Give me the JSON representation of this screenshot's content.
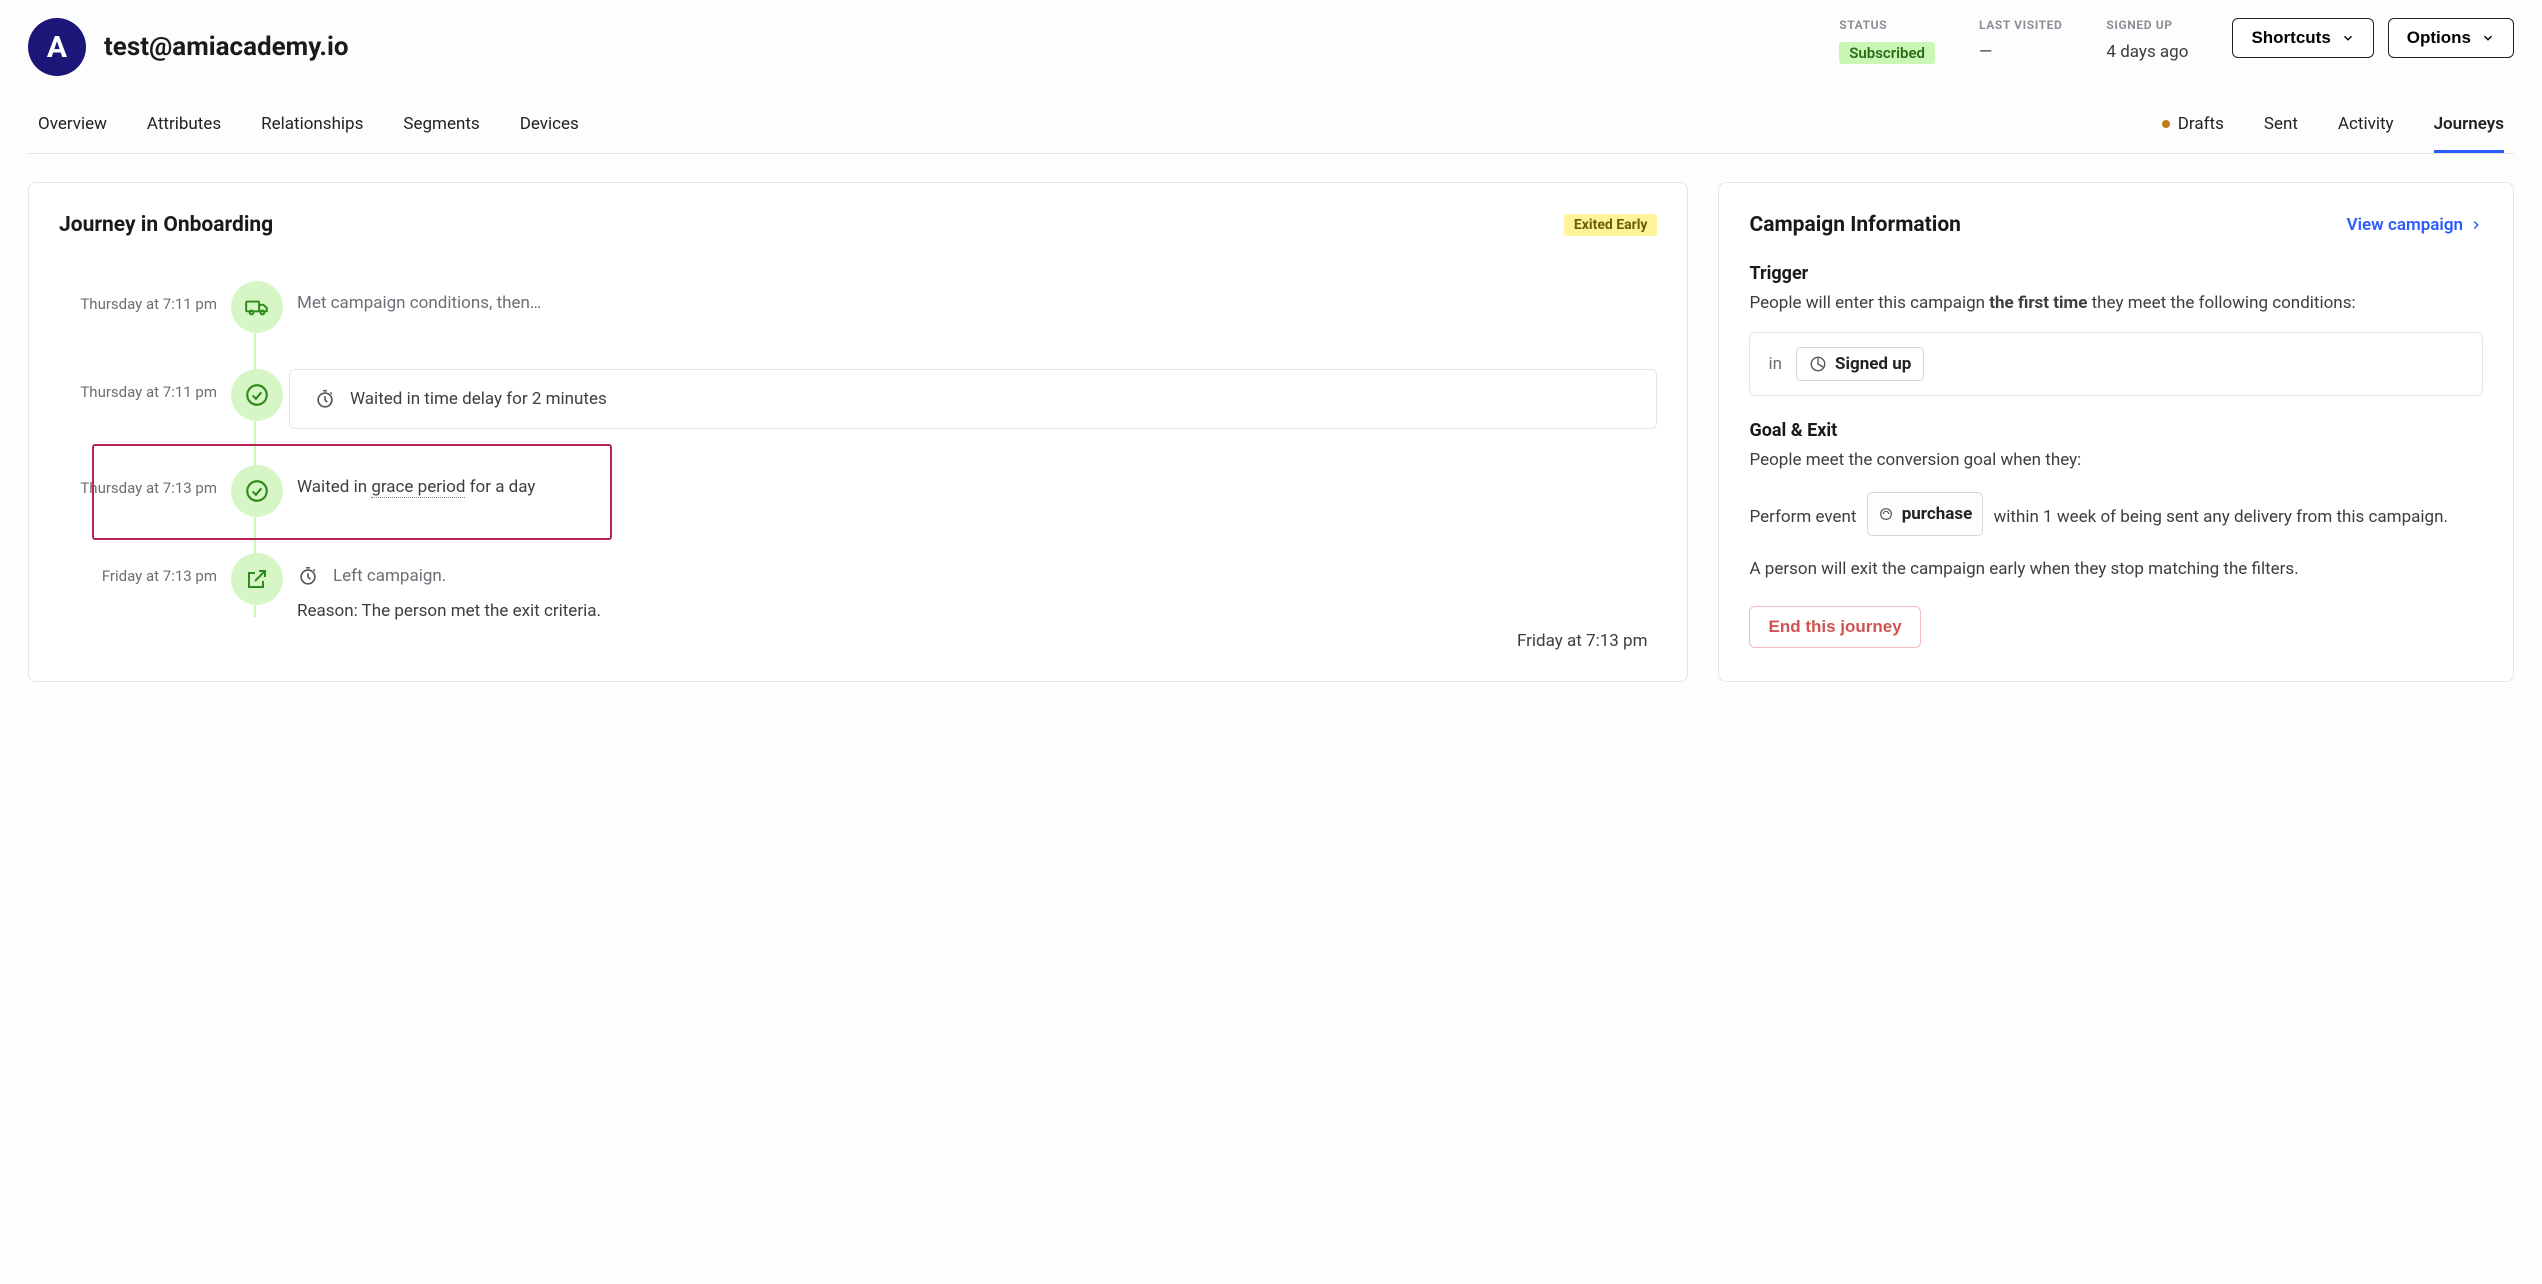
{
  "header": {
    "avatar_initial": "A",
    "email": "test@amiacademy.io",
    "status_label": "STATUS",
    "status_value": "Subscribed",
    "last_visited_label": "LAST VISITED",
    "last_visited_value": "—",
    "signed_up_label": "SIGNED UP",
    "signed_up_value": "4 days ago",
    "shortcuts_label": "Shortcuts",
    "options_label": "Options"
  },
  "tabs": {
    "overview": "Overview",
    "attributes": "Attributes",
    "relationships": "Relationships",
    "segments": "Segments",
    "devices": "Devices",
    "drafts": "Drafts",
    "sent": "Sent",
    "activity": "Activity",
    "journeys": "Journeys"
  },
  "journey": {
    "title": "Journey in Onboarding",
    "badge": "Exited Early",
    "events": [
      {
        "time": "Thursday at 7:11 pm",
        "text": "Met campaign conditions, then…"
      },
      {
        "time": "Thursday at 7:11 pm",
        "text": "Waited in time delay for 2 minutes"
      },
      {
        "time": "Thursday at 7:13 pm",
        "pre": "Waited in ",
        "link": "grace period",
        "post": " for a day"
      },
      {
        "time": "Friday at 7:13 pm",
        "text": "Left campaign.",
        "reason": "Reason: The person met the exit criteria.",
        "foot_ts": "Friday at 7:13 pm"
      }
    ]
  },
  "campaign": {
    "title": "Campaign Information",
    "view_link": "View campaign",
    "trigger_h": "Trigger",
    "trigger_pre": "People will enter this campaign ",
    "trigger_strong": "the first time",
    "trigger_post": " they meet the following conditions:",
    "cond_in": "in",
    "cond_chip": "Signed up",
    "goal_h": "Goal & Exit",
    "goal_intro": "People meet the conversion goal when they:",
    "goal_perform": "Perform event",
    "goal_event": "purchase",
    "goal_tail": "within 1 week of being sent any delivery from this campaign.",
    "exit_text": "A person will exit the campaign early when they stop matching the filters.",
    "end_btn": "End this journey"
  }
}
